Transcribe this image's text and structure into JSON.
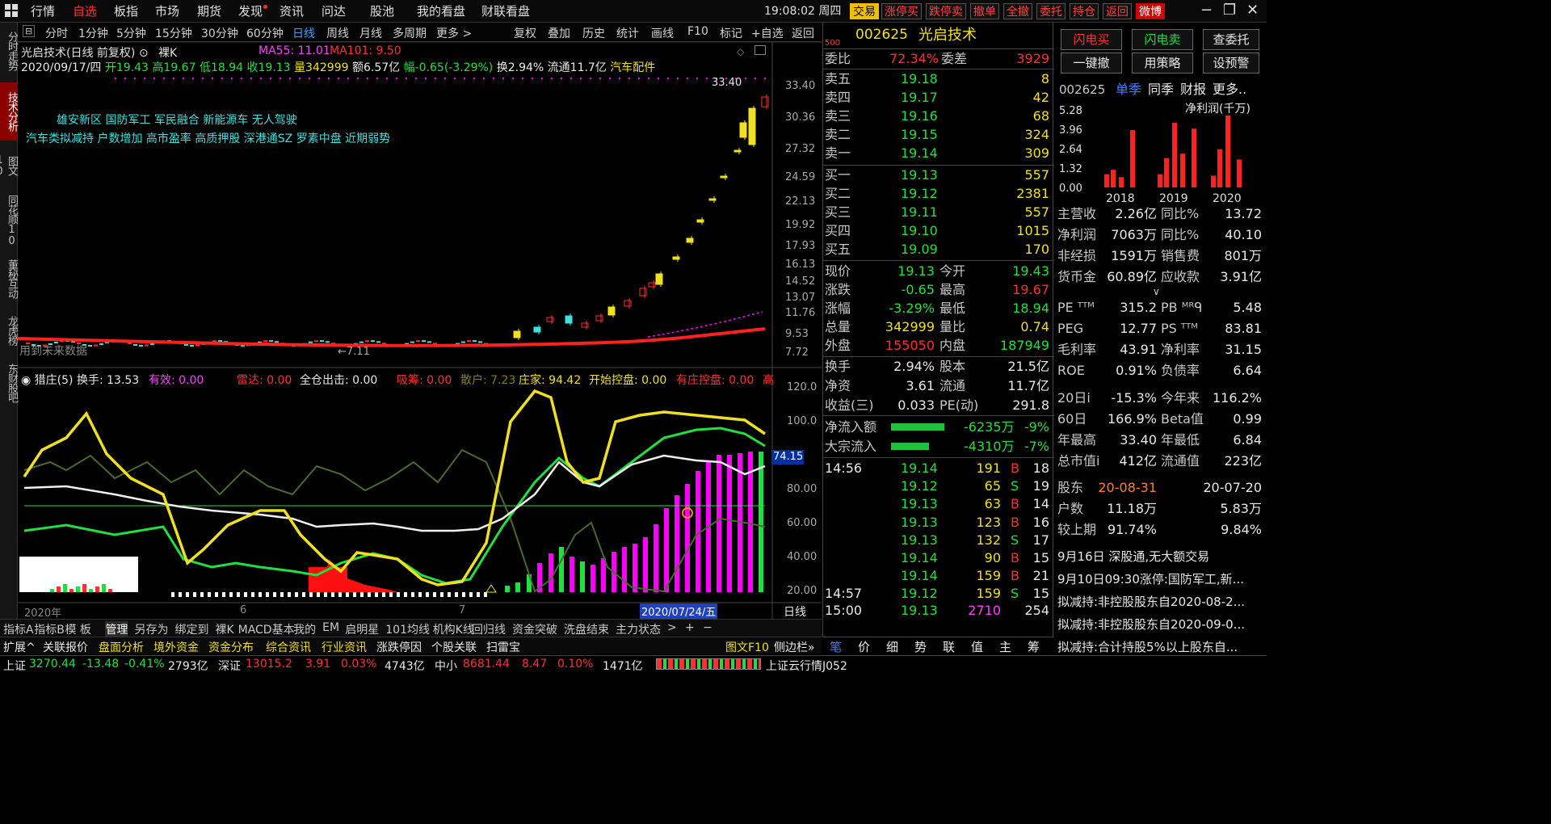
{
  "topbar": {
    "nav": [
      "行情",
      "自选",
      "板指",
      "市场",
      "期货",
      "发现",
      "资讯",
      "问达",
      "股池",
      "我的看盘",
      "财联看盘"
    ],
    "active_nav": "自选",
    "time": "19:08:02",
    "weekday": "周四",
    "trade_buttons": [
      "交易",
      "涨停买",
      "跌停卖",
      "撤单",
      "全撤",
      "委托",
      "持仓",
      "返回",
      "微博"
    ]
  },
  "leftbar": {
    "tabs": [
      "分时走势",
      "技术分析",
      "图文10",
      "同花顺10",
      "董秘互动",
      "龙虎榜",
      "东财股吧"
    ],
    "active": "技术分析"
  },
  "chartbar": {
    "items": [
      "分时",
      "1分钟",
      "5分钟",
      "15分钟",
      "30分钟",
      "60分钟",
      "日线",
      "周线",
      "月线",
      "多周期",
      "更多 >"
    ],
    "active": "日线",
    "tools": [
      "复权",
      "叠加",
      "历史",
      "统计",
      "画线",
      "F10",
      "标记",
      "+自选",
      "返回"
    ]
  },
  "kinfo": {
    "title": "光启技术(日线 前复权) ⊙",
    "mode": "裸K",
    "ma55": "MA55: 11.01",
    "ma101": "MA101: 9.50",
    "line2": {
      "date": "2020/09/17/四",
      "open": "开19.43",
      "high": "高19.67",
      "low": "低18.94",
      "close": "收19.13",
      "vol": "量342999",
      "amt": "额6.57亿",
      "chg": "幅-0.65(-3.29%)",
      "turn": "换2.94%",
      "float": "流通11.7亿",
      "sector": "汽车配件"
    },
    "concepts1": "雄安新区 国防军工 军民融合 新能源车 无人驾驶",
    "concepts2": "汽车类拟减持 户数增加 高市盈率 高质押股 深港通SZ 罗素中盘 近期弱势",
    "max_label": "33.40",
    "min_label": "7.11",
    "watermark": "用到未来数据",
    "price_axis": [
      "33.40",
      "30.36",
      "27.32",
      "24.59",
      "22.13",
      "19.92",
      "17.93",
      "16.13",
      "14.52",
      "13.07",
      "11.76",
      "9.53",
      "7.72"
    ]
  },
  "indicator": {
    "name": "猎庄(5)",
    "turn": "换手: 13.53",
    "valid": "有效: 0.00",
    "radar": "雷达: 0.00",
    "fullout": "全仓出击: 0.00",
    "absorb": "吸筹: 0.00",
    "retail": "散户: 7.23",
    "dealer": "庄家: 94.42",
    "start": "开始控盘: 0.00",
    "have": "有庄控盘: 0.00",
    "high": "高",
    "axis": [
      "120.0",
      "100.0",
      "80.00",
      "60.00",
      "40.00",
      "20.00"
    ],
    "current": "74.15"
  },
  "xaxis": {
    "labels": [
      "2020年",
      "6",
      "7"
    ],
    "cursor": "2020/07/24/五",
    "period": "日线"
  },
  "bottomtabs": [
    "指标A",
    "指标B",
    "模 板",
    "管理",
    "另存为",
    "绑定到",
    "裸K",
    "MACD基本",
    "我的",
    "EM",
    "启明星",
    "101均线",
    "机构K线",
    "回归线",
    "资金突破",
    "洗盘结束",
    "主力状态",
    ">",
    "+",
    "−"
  ],
  "bottom_active": "管理",
  "toolrow": [
    {
      "t": "扩展^",
      "c": "w"
    },
    {
      "t": "关联报价",
      "c": "w"
    },
    {
      "t": "盘面分析",
      "c": "y"
    },
    {
      "t": "境外资金",
      "c": "y"
    },
    {
      "t": "资金分布",
      "c": "y"
    },
    {
      "t": "综合资讯",
      "c": "y"
    },
    {
      "t": "行业资讯",
      "c": "y"
    },
    {
      "t": "涨跌停因",
      "c": "w"
    },
    {
      "t": "个股关联",
      "c": "w"
    },
    {
      "t": "扫雷宝",
      "c": "w"
    },
    {
      "t": "图文F10",
      "c": "y"
    },
    {
      "t": "侧边栏»",
      "c": "w"
    }
  ],
  "quote": {
    "mark": "500",
    "code": "002625",
    "name": "光启技术",
    "weibi_label": "委比",
    "weibi": "72.34%",
    "weicha_label": "委差",
    "weicha": "3929",
    "asks": [
      [
        "卖五",
        "19.18",
        "8"
      ],
      [
        "卖四",
        "19.17",
        "42"
      ],
      [
        "卖三",
        "19.16",
        "68"
      ],
      [
        "卖二",
        "19.15",
        "324"
      ],
      [
        "卖一",
        "19.14",
        "309"
      ]
    ],
    "bids": [
      [
        "买一",
        "19.13",
        "557"
      ],
      [
        "买二",
        "19.12",
        "2381"
      ],
      [
        "买三",
        "19.11",
        "557"
      ],
      [
        "买四",
        "19.10",
        "1015"
      ],
      [
        "买五",
        "19.09",
        "170"
      ]
    ],
    "stats": [
      [
        "现价",
        "19.13",
        "今开",
        "19.43"
      ],
      [
        "涨跌",
        "-0.65",
        "最高",
        "19.67"
      ],
      [
        "涨幅",
        "-3.29%",
        "最低",
        "18.94"
      ],
      [
        "总量",
        "342999",
        "量比",
        "0.74"
      ],
      [
        "外盘",
        "155050",
        "内盘",
        "187949"
      ]
    ],
    "stats2": [
      [
        "换手",
        "2.94%",
        "股本",
        "21.5亿"
      ],
      [
        "净资",
        "3.61",
        "流通",
        "11.7亿"
      ],
      [
        "收益(三)",
        "0.033",
        "PE(动)",
        "291.8"
      ]
    ],
    "flows": [
      [
        "净流入额",
        "-6235万",
        "-9%",
        0.78
      ],
      [
        "大宗流入",
        "-4310万",
        "-7%",
        0.55
      ]
    ],
    "ticks": [
      [
        "14:56",
        "19.14",
        "191",
        "B",
        "18"
      ],
      [
        "",
        "19.12",
        "65",
        "S",
        "19"
      ],
      [
        "",
        "19.13",
        "63",
        "B",
        "14"
      ],
      [
        "",
        "19.13",
        "123",
        "B",
        "16"
      ],
      [
        "",
        "19.13",
        "132",
        "S",
        "17"
      ],
      [
        "",
        "19.14",
        "90",
        "B",
        "15"
      ],
      [
        "",
        "19.14",
        "159",
        "B",
        "21"
      ],
      [
        "14:57",
        "19.12",
        "159",
        "S",
        "15"
      ],
      [
        "15:00",
        "19.13",
        "2710",
        "",
        "254"
      ]
    ],
    "tabs": [
      "笔",
      "价",
      "细",
      "势",
      "联",
      "值",
      "主",
      "筹"
    ]
  },
  "fin": {
    "buttons": [
      "闪电买",
      "闪电卖",
      "查委托",
      "一键撤",
      "用策略",
      "设预警"
    ],
    "code": "002625",
    "tabs": [
      "单季",
      "同季",
      "财报",
      "更多.."
    ],
    "active_tab": "单季",
    "chart_data": {
      "type": "bar",
      "title": "净利润(千万)",
      "ylim": [
        0,
        5.28
      ],
      "yticks": [
        "5.28",
        "3.96",
        "2.64",
        "1.32",
        "0.00"
      ],
      "xlabels": [
        "2018",
        "2019",
        "2020"
      ],
      "values": [
        0.9,
        1.2,
        0.7,
        3.9,
        0.9,
        2.0,
        4.4,
        2.3,
        4.0,
        0.8,
        2.6,
        4.9,
        1.9
      ]
    },
    "rows1": [
      [
        "主营收",
        "2.26亿",
        "同比%",
        "13.72"
      ],
      [
        "净利润",
        "7063万",
        "同比%",
        "40.10"
      ],
      [
        "非经损",
        "1591万",
        "销售费",
        "801万"
      ],
      [
        "货币金",
        "60.89亿",
        "应收款",
        "3.91亿"
      ]
    ],
    "rows2": [
      [
        "PE ᵀᵀᴹ",
        "315.2",
        "PB ᴹᴿᑫ",
        "5.48"
      ],
      [
        "PEG",
        "12.77",
        "PS ᵀᵀᴹ",
        "83.81"
      ],
      [
        "毛利率",
        "43.91",
        "净利率",
        "31.15"
      ],
      [
        "ROE",
        "0.91%",
        "负债率",
        "6.64"
      ]
    ],
    "rows3": [
      [
        "20日i",
        "-15.3%",
        "今年来",
        "116.2%"
      ],
      [
        "60日",
        "166.9%",
        "Beta值",
        "0.99"
      ],
      [
        "年最高",
        "33.40",
        "年最低",
        "6.84"
      ],
      [
        "总市值i",
        "412亿",
        "流通值",
        "223亿"
      ]
    ],
    "holders": [
      [
        "股东",
        "20-08-31",
        "20-07-20"
      ],
      [
        "户数",
        "11.18万",
        "5.83万"
      ],
      [
        "较上期",
        "91.74%",
        "9.84%"
      ]
    ],
    "news": [
      "9月16日 深股通,无大额交易",
      "9月10日09:30涨停:国防军工,新...",
      "拟减持:非控股股东自2020-08-2...",
      "拟减持:非控股股东自2020-09-0...",
      "拟减持:合计持股5%以上股东自..."
    ]
  },
  "status": {
    "sh_label": "上证",
    "sh": "3270.44",
    "sh_chg": "-13.48",
    "sh_pct": "-0.41%",
    "sh_amt": "2793亿",
    "sz_label": "深证",
    "sz": "13015.2",
    "sz_chg": "3.91",
    "sz_pct": "0.03%",
    "sz_amt": "4743亿",
    "zx_label": "中小",
    "zx": "8681.44",
    "zx_chg": "8.47",
    "zx_pct": "0.10%",
    "zx_amt": "1471亿",
    "cloud": "上证云行情J052"
  },
  "colors": {
    "up": "#ff3030",
    "down": "#20e040",
    "yellow": "#f0e020",
    "magenta": "#ff00ff",
    "cyan": "#40e0e0"
  }
}
